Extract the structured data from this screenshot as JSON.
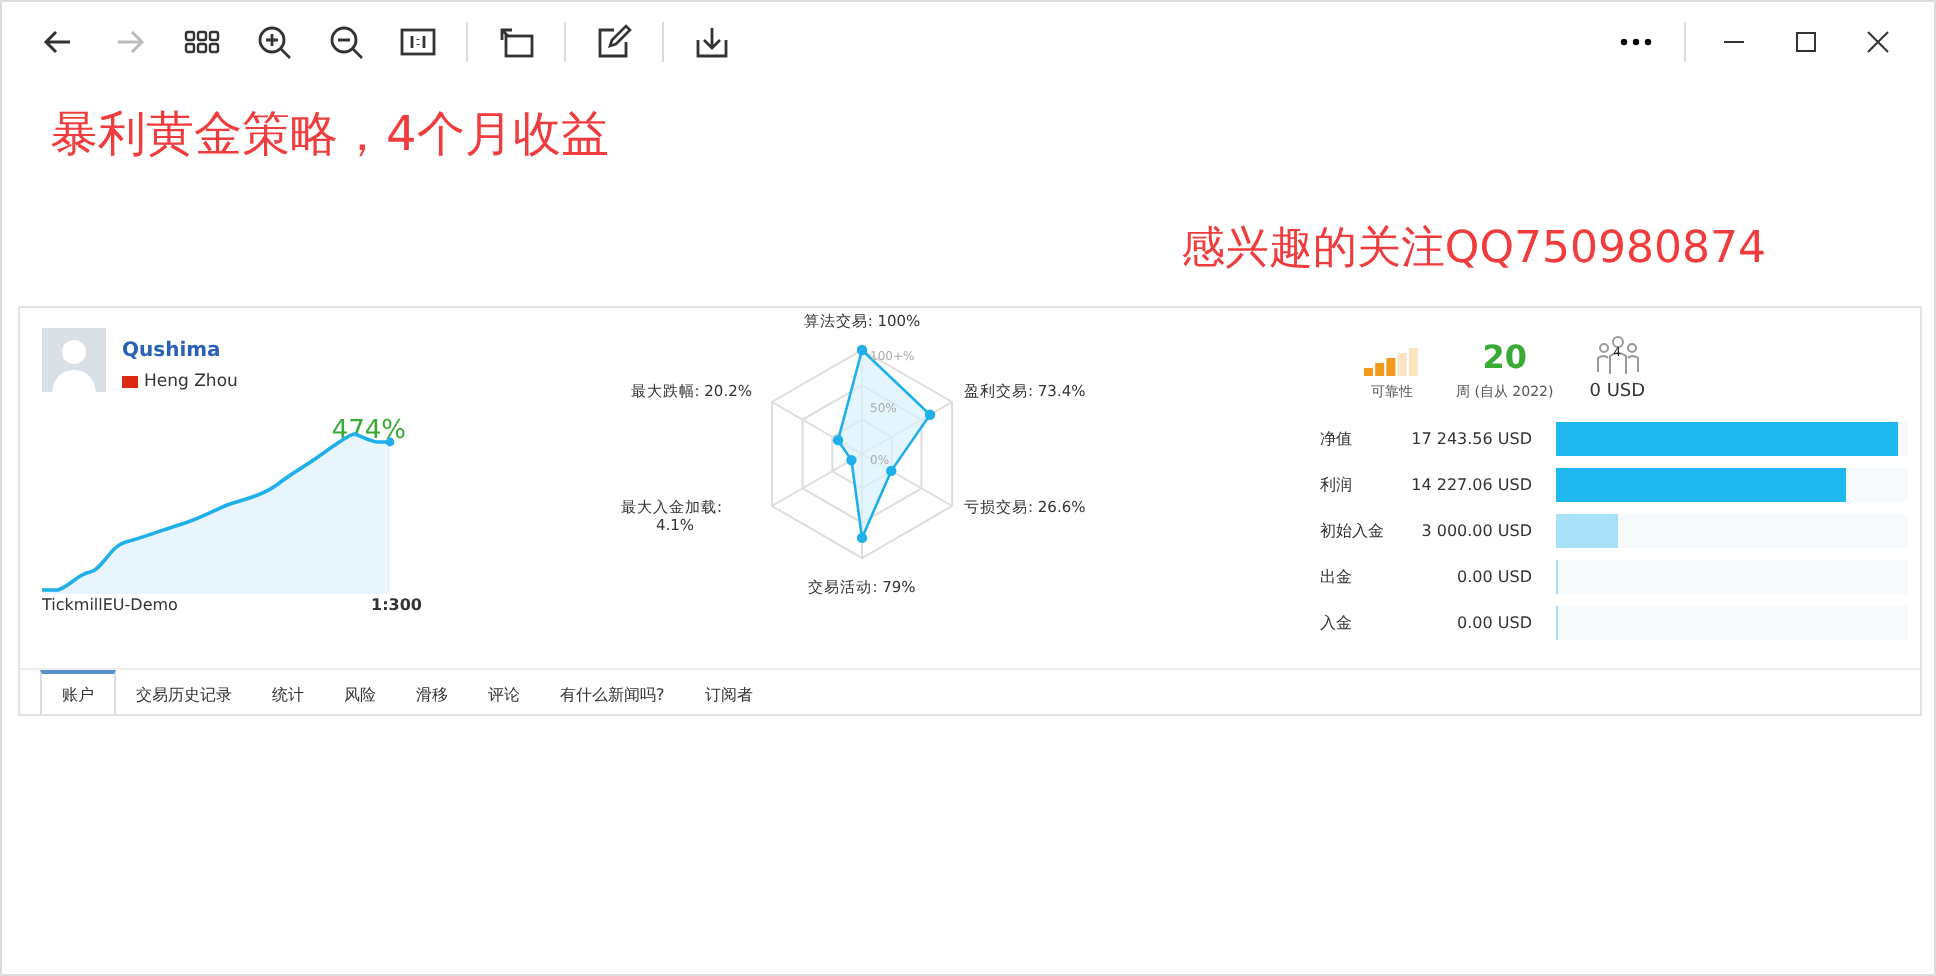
{
  "toolbar": {
    "buttons": [
      {
        "kind": "back",
        "disabled": false
      },
      {
        "kind": "forward",
        "disabled": true
      },
      {
        "kind": "grid",
        "disabled": false
      },
      {
        "kind": "zoom-in",
        "disabled": false
      },
      {
        "kind": "zoom-out",
        "disabled": false
      },
      {
        "kind": "actual-size",
        "disabled": false
      },
      {
        "kind": "rotate",
        "disabled": false
      },
      {
        "kind": "edit",
        "disabled": false
      },
      {
        "kind": "download",
        "disabled": false
      }
    ]
  },
  "headline": "暴利黄金策略，4个月收益",
  "subline": "感兴趣的关注QQ750980874",
  "profile": {
    "name": "Qushima",
    "location": "Heng Zhou",
    "growth": "474%",
    "server": "TickmillEU-Demo",
    "leverage": "1:300"
  },
  "radar": {
    "labels": [
      {
        "text": "算法交易: 100%"
      },
      {
        "text": "最大跌幅: 20.2%"
      },
      {
        "text": "盈利交易: 73.4%"
      },
      {
        "text": "最大入金加载:\n4.1%"
      },
      {
        "text": "亏损交易: 26.6%"
      },
      {
        "text": "交易活动: 79%"
      }
    ],
    "scale": [
      "100+%",
      "50%",
      "0%"
    ]
  },
  "stats": {
    "reliability_label": "可靠性",
    "weeks": "20",
    "weeks_label": "周 (自从 2022)",
    "subscribers_count": "4",
    "subscribers_value": "0 USD"
  },
  "bars": [
    {
      "label": "净值",
      "value": "17 243.56 USD",
      "level": 0.97,
      "color": "#1fb8f0"
    },
    {
      "label": "利润",
      "value": "14 227.06 USD",
      "level": 0.825,
      "color": "#1fb8f0"
    },
    {
      "label": "初始入金",
      "value": "3 000.00 USD",
      "level": 0.174,
      "color": "#a8e0f8"
    },
    {
      "label": "出金",
      "value": "0.00 USD",
      "level": 0.004,
      "color": "#a8e0f8"
    },
    {
      "label": "入金",
      "value": "0.00 USD",
      "level": 0.004,
      "color": "#a8e0f8"
    }
  ],
  "tabs": [
    {
      "label": "账户",
      "selected": true
    },
    {
      "label": "交易历史记录",
      "selected": false
    },
    {
      "label": "统计",
      "selected": false
    },
    {
      "label": "风险",
      "selected": false
    },
    {
      "label": "滑移",
      "selected": false
    },
    {
      "label": "评论",
      "selected": false
    },
    {
      "label": "有什么新闻吗?",
      "selected": false
    },
    {
      "label": "订阅者",
      "selected": false
    }
  ]
}
